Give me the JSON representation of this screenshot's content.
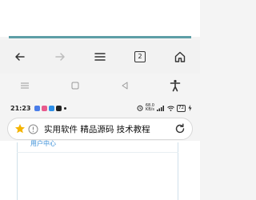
{
  "progress": {
    "percent": 100
  },
  "toolbar": {
    "back_icon": "arrow-left-icon",
    "forward_icon": "arrow-right-icon",
    "menu_icon": "hamburger-icon",
    "tab_count": "2",
    "home_icon": "home-icon"
  },
  "navbar": {
    "menu_icon": "hamburger-icon",
    "home_icon": "square-icon",
    "back_icon": "triangle-back-icon",
    "accessibility_icon": "accessibility-icon"
  },
  "statusbar": {
    "time": "21:23",
    "netspeed_value": "68.0",
    "netspeed_unit": "KB/s",
    "battery": "72"
  },
  "urlbar": {
    "text": "实用软件 精品源码 技术教程"
  },
  "page": {
    "partial_link": "用户中心"
  },
  "colors": {
    "accent": "#5d9ea6",
    "link": "#3a8fd8",
    "star": "#f5b400"
  }
}
